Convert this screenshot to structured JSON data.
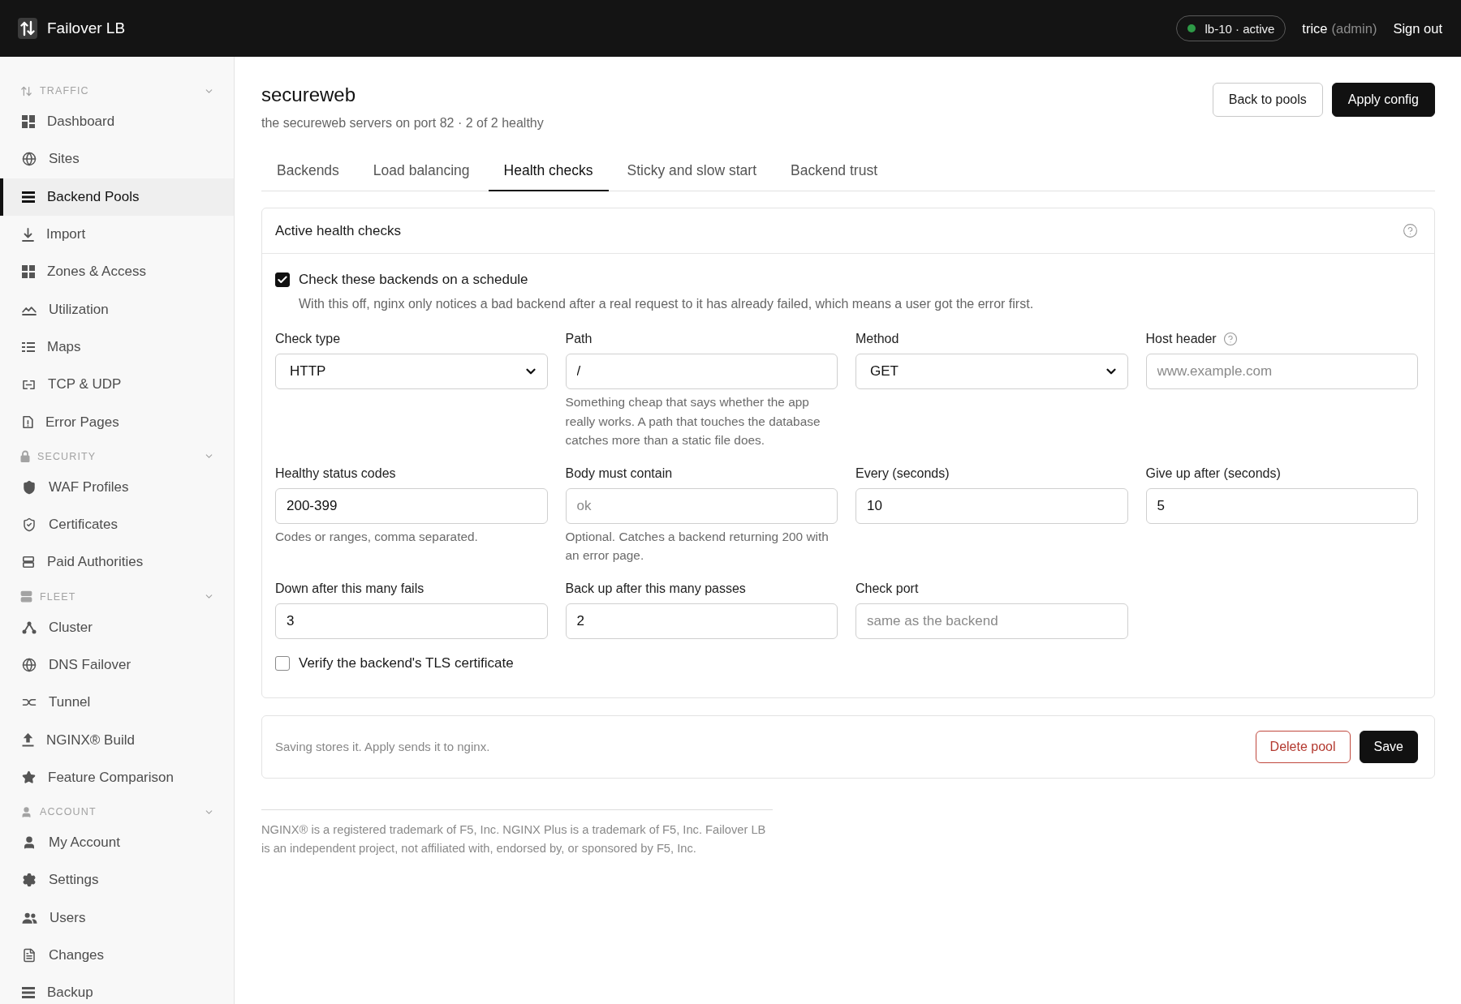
{
  "topbar": {
    "app_name": "Failover LB",
    "node": {
      "label": "lb-10 · active",
      "online": true
    },
    "user": {
      "name": "trice",
      "role": "(admin)"
    },
    "sign_out": "Sign out"
  },
  "sidebar": {
    "sections": [
      {
        "title": "TRAFFIC",
        "expanded": true,
        "items": [
          {
            "label": "Dashboard",
            "selected": false
          },
          {
            "label": "Sites",
            "selected": false
          },
          {
            "label": "Backend Pools",
            "selected": true
          },
          {
            "label": "Import",
            "selected": false
          },
          {
            "label": "Zones & Access",
            "selected": false
          },
          {
            "label": "Utilization",
            "selected": false
          },
          {
            "label": "Maps",
            "selected": false
          },
          {
            "label": "TCP & UDP",
            "selected": false
          },
          {
            "label": "Error Pages",
            "selected": false
          }
        ]
      },
      {
        "title": "SECURITY",
        "expanded": true,
        "items": [
          {
            "label": "WAF Profiles",
            "selected": false
          },
          {
            "label": "Certificates",
            "selected": false
          },
          {
            "label": "Paid Authorities",
            "selected": false
          }
        ]
      },
      {
        "title": "FLEET",
        "expanded": true,
        "items": [
          {
            "label": "Cluster",
            "selected": false
          },
          {
            "label": "DNS Failover",
            "selected": false
          },
          {
            "label": "Tunnel",
            "selected": false
          },
          {
            "label": "NGINX® Build",
            "selected": false
          },
          {
            "label": "Feature Comparison",
            "selected": false
          }
        ]
      },
      {
        "title": "ACCOUNT",
        "expanded": true,
        "items": [
          {
            "label": "My Account",
            "selected": false
          },
          {
            "label": "Settings",
            "selected": false
          },
          {
            "label": "Users",
            "selected": false
          },
          {
            "label": "Changes",
            "selected": false
          },
          {
            "label": "Backup",
            "selected": false
          }
        ]
      }
    ]
  },
  "page": {
    "title": "secureweb",
    "subtitle": "the secureweb servers on port 82 · 2 of 2 healthy",
    "actions": [
      {
        "label": "Back to pools",
        "kind": "secondary"
      },
      {
        "label": "Apply config",
        "kind": "primary"
      }
    ]
  },
  "tabs": [
    {
      "label": "Backends",
      "selected": false
    },
    {
      "label": "Load balancing",
      "selected": false
    },
    {
      "label": "Health checks",
      "selected": true
    },
    {
      "label": "Sticky and slow start",
      "selected": false
    },
    {
      "label": "Backend trust",
      "selected": false
    }
  ],
  "health_card": {
    "title": "Active health checks",
    "schedule": {
      "label": "Check these backends on a schedule",
      "checked": true,
      "description": "With this off, nginx only notices a bad backend after a real request to it has already failed, which means a user got the error first."
    },
    "fields": [
      {
        "kind": "select",
        "label": "Check type",
        "value": "HTTP",
        "help": false
      },
      {
        "kind": "input",
        "label": "Path",
        "value": "/",
        "help": false,
        "hint": "Something cheap that says whether the app really works. A path that touches the database catches more than a static file does."
      },
      {
        "kind": "select",
        "label": "Method",
        "value": "GET",
        "help": false
      },
      {
        "kind": "input",
        "label": "Host header",
        "placeholder": "www.example.com",
        "help": true
      },
      {
        "kind": "input",
        "label": "Healthy status codes",
        "value": "200-399",
        "help": false,
        "hint": "Codes or ranges, comma separated."
      },
      {
        "kind": "input",
        "label": "Body must contain",
        "placeholder": "ok",
        "help": false,
        "hint": "Optional. Catches a backend returning 200 with an error page."
      },
      {
        "kind": "input",
        "label": "Every (seconds)",
        "value": "10",
        "help": false
      },
      {
        "kind": "input",
        "label": "Give up after (seconds)",
        "value": "5",
        "help": false
      },
      {
        "kind": "input",
        "label": "Down after this many fails",
        "value": "3",
        "help": false
      },
      {
        "kind": "input",
        "label": "Back up after this many passes",
        "value": "2",
        "help": false
      },
      {
        "kind": "input",
        "label": "Check port",
        "placeholder": "same as the backend",
        "help": false
      }
    ],
    "verify_tls": {
      "label": "Verify the backend's TLS certificate",
      "checked": false
    }
  },
  "save_bar": {
    "note": "Saving stores it. Apply sends it to nginx.",
    "actions": [
      {
        "label": "Delete pool",
        "kind": "danger"
      },
      {
        "label": "Save",
        "kind": "primary"
      }
    ]
  },
  "footer": {
    "text": "NGINX® is a registered trademark of F5, Inc. NGINX Plus is a trademark of F5, Inc. Failover LB is an independent project, not affiliated with, endorsed by, or sponsored by F5, Inc."
  }
}
